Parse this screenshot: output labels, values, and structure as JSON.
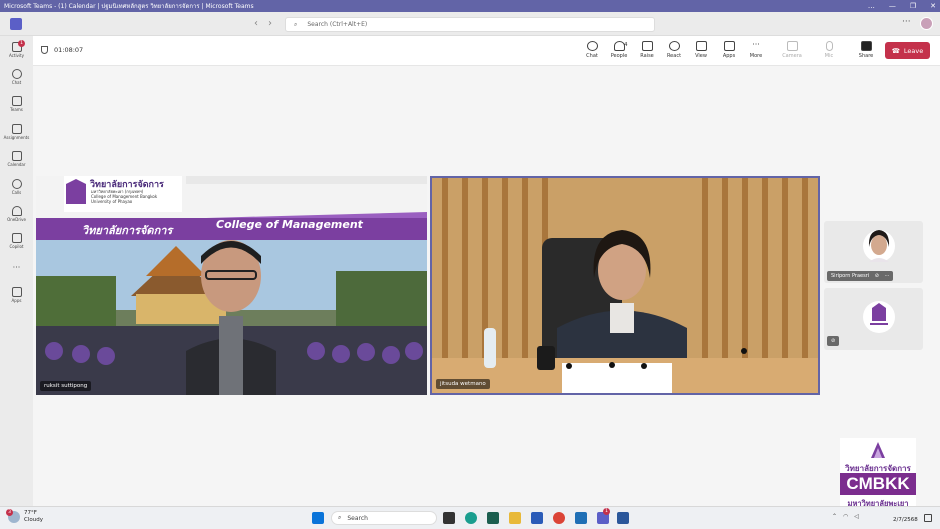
{
  "window": {
    "title": "Microsoft Teams - (1) Calendar | ปฐมนิเทศหลักสูตร วิทยาลัยการจัดการ | Microsoft Teams",
    "controls": [
      "…",
      "—",
      "❐",
      "✕"
    ]
  },
  "topbar": {
    "search_placeholder": "Search (Ctrl+Alt+E)",
    "more": "···"
  },
  "rail": {
    "items": [
      {
        "label": "Activity",
        "badge": "1"
      },
      {
        "label": "Chat"
      },
      {
        "label": "Teams"
      },
      {
        "label": "Assignments"
      },
      {
        "label": "Calendar"
      },
      {
        "label": "Calls"
      },
      {
        "label": "OneDrive"
      },
      {
        "label": "Copilot"
      },
      {
        "label": "···"
      },
      {
        "label": "Apps"
      }
    ]
  },
  "meeting": {
    "timer": "01:08:07",
    "controls": [
      {
        "label": "Chat",
        "icon": "chat-icon"
      },
      {
        "label": "People",
        "icon": "people-icon",
        "count": "4"
      },
      {
        "label": "Raise",
        "icon": "hand-icon"
      },
      {
        "label": "React",
        "icon": "smile-icon"
      },
      {
        "label": "View",
        "icon": "grid-icon"
      },
      {
        "label": "Apps",
        "icon": "plus-icon"
      },
      {
        "label": "More",
        "icon": "more-icon"
      },
      {
        "label": "Camera",
        "icon": "camera-off-icon",
        "disabled": true
      },
      {
        "label": "Mic",
        "icon": "mic-off-icon",
        "disabled": true
      },
      {
        "label": "Share",
        "icon": "share-icon"
      }
    ],
    "leave_label": "Leave"
  },
  "participants": {
    "main": [
      {
        "name": "ruksit suttipong"
      },
      {
        "name": "jitsuda wetmano"
      }
    ],
    "side": [
      {
        "name": "Siriporn Praesri"
      },
      {
        "name": ""
      }
    ]
  },
  "slide": {
    "logo_th": "วิทยาลัยการจัดการ",
    "logo_sub1": "มหาวิทยาลัยพะเยา (กรุงเทพฯ)",
    "logo_sub2": "College of Management Bangkok",
    "logo_sub3": "University of Phayao",
    "banner_th": "วิทยาลัยการจัดการ",
    "banner_en": "College of Management"
  },
  "watermark": {
    "line1": "วิทยาลัยการจัดการ",
    "line2": "CMBKK",
    "line3": "มหาวิทยาลัยพะเยา"
  },
  "taskbar": {
    "weather_temp": "77°F",
    "weather_text": "Cloudy",
    "weather_badge": "3",
    "search_label": "Search",
    "clock": "2/7/2568",
    "teams_badge": "1"
  },
  "colors": {
    "teams_purple": "#6264a7",
    "leave_red": "#c4314b",
    "slide_purple": "#7b3fa0"
  }
}
